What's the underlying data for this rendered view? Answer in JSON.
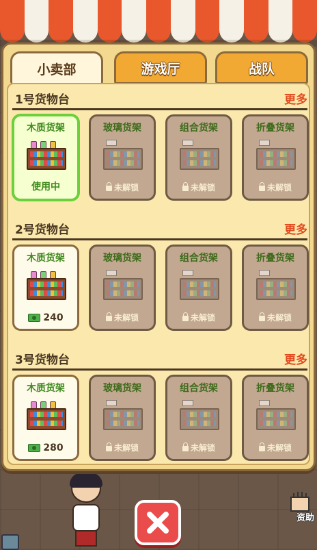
{
  "tabs": [
    {
      "label": "小卖部",
      "active": true
    },
    {
      "label": "游戏厅",
      "active": false
    },
    {
      "label": "战队",
      "active": false
    }
  ],
  "sections": [
    {
      "title": "1号货物台",
      "more": "更多",
      "cards": [
        {
          "name": "木质货架",
          "state": "in-use",
          "footer": "使用中"
        },
        {
          "name": "玻璃货架",
          "state": "locked",
          "footer": "未解锁"
        },
        {
          "name": "组合货架",
          "state": "locked",
          "footer": "未解锁"
        },
        {
          "name": "折叠货架",
          "state": "locked",
          "footer": "未解锁"
        }
      ]
    },
    {
      "title": "2号货物台",
      "more": "更多",
      "cards": [
        {
          "name": "木质货架",
          "state": "purchasable",
          "footer": "240"
        },
        {
          "name": "玻璃货架",
          "state": "locked",
          "footer": "未解锁"
        },
        {
          "name": "组合货架",
          "state": "locked",
          "footer": "未解锁"
        },
        {
          "name": "折叠货架",
          "state": "locked",
          "footer": "未解锁"
        }
      ]
    },
    {
      "title": "3号货物台",
      "more": "更多",
      "cards": [
        {
          "name": "木质货架",
          "state": "purchasable",
          "footer": "280"
        },
        {
          "name": "玻璃货架",
          "state": "locked",
          "footer": "未解锁"
        },
        {
          "name": "组合货架",
          "state": "locked",
          "footer": "未解锁"
        },
        {
          "name": "折叠货架",
          "state": "locked",
          "footer": "未解锁"
        }
      ]
    }
  ],
  "background": {
    "side_label": "资助"
  },
  "icons": {
    "close": "close-icon",
    "lock": "lock-icon",
    "cash": "cash-icon"
  },
  "colors": {
    "accent_red": "#e24a1e",
    "in_use_green": "#6ccf3c",
    "tab_orange": "#f2a933",
    "close_red": "#ea4b4b"
  }
}
